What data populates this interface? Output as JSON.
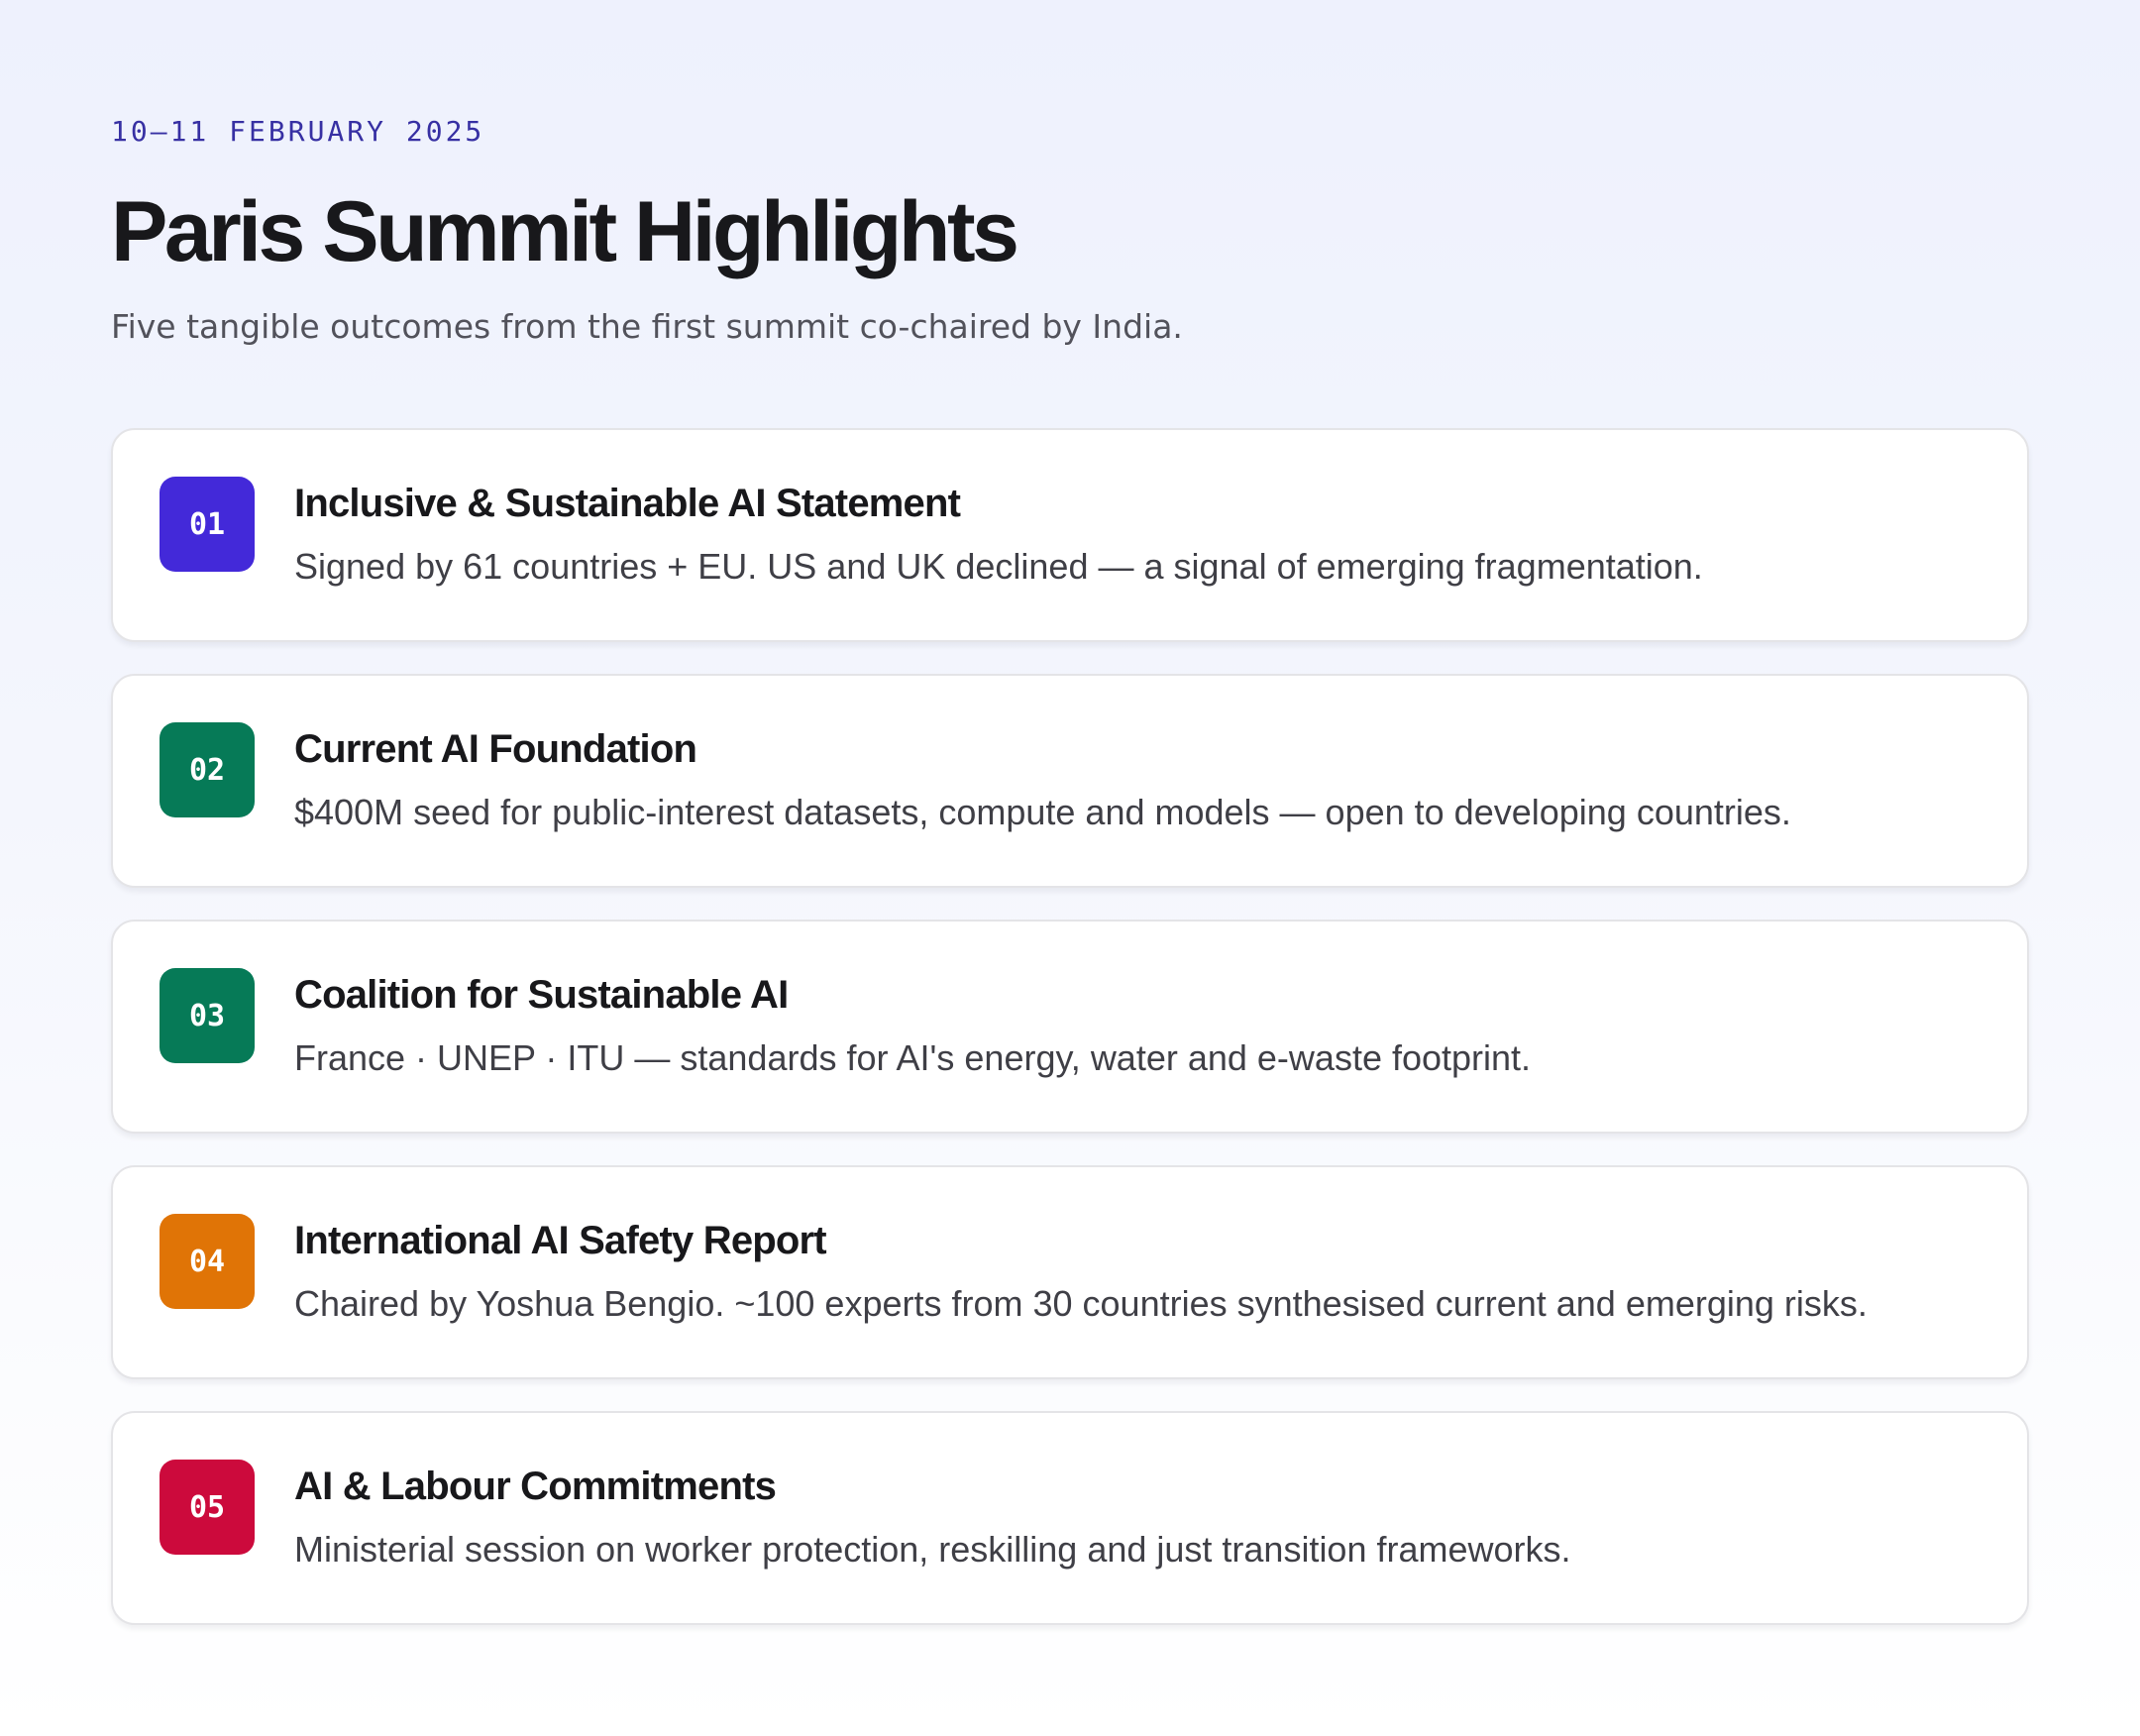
{
  "header": {
    "eyebrow": "10–11 FEBRUARY 2025",
    "title": "Paris Summit Highlights",
    "subtitle": "Five tangible outcomes from the first summit co-chaired by India."
  },
  "items": [
    {
      "number": "01",
      "title": "Inclusive & Sustainable AI Statement",
      "description": "Signed by 61 countries + EU. US and UK declined — a signal of emerging fragmentation.",
      "color": "#4329d9"
    },
    {
      "number": "02",
      "title": "Current AI Foundation",
      "description": "$400M seed for public-interest datasets, compute and models — open to developing countries.",
      "color": "#067a57"
    },
    {
      "number": "03",
      "title": "Coalition for Sustainable AI",
      "description": "France · UNEP · ITU — standards for AI's energy, water and e-waste footprint.",
      "color": "#067a57"
    },
    {
      "number": "04",
      "title": "International AI Safety Report",
      "description": "Chaired by Yoshua Bengio. ~100 experts from 30 countries synthesised current and emerging risks.",
      "color": "#e07406"
    },
    {
      "number": "05",
      "title": "AI & Labour Commitments",
      "description": "Ministerial session on worker protection, reskilling and just transition frameworks.",
      "color": "#cc0a3c"
    }
  ]
}
